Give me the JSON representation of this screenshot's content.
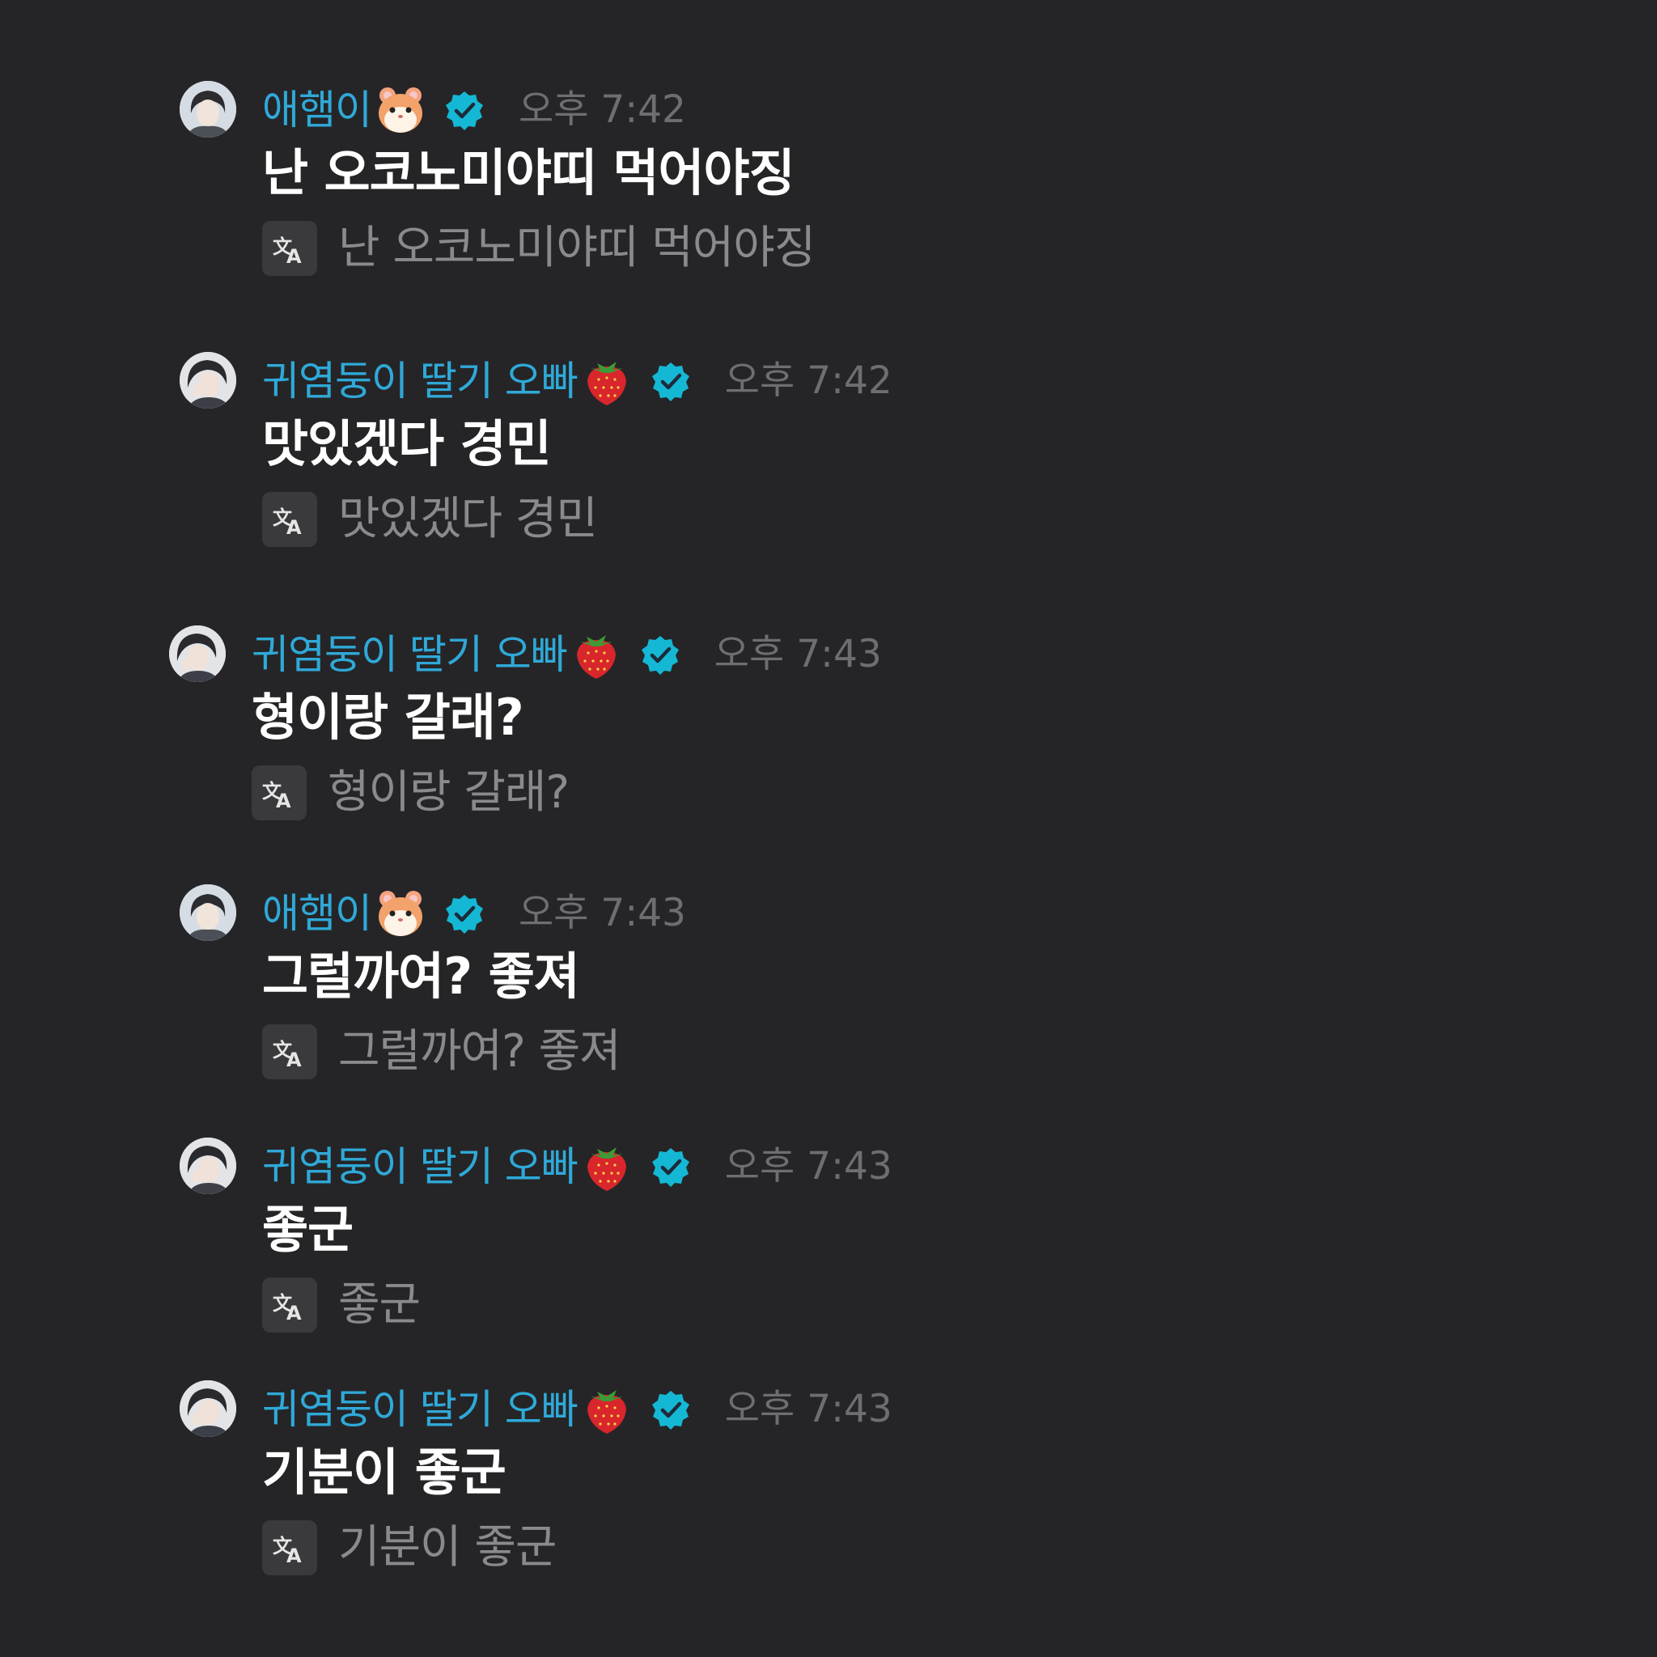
{
  "messages": [
    {
      "sender": "애햄이",
      "sender_emoji": "hamster-emoji",
      "time": "오후 7:42",
      "text": "난 오코노미야띠 먹어야징",
      "translation": "난 오코노미야띠 먹어야징"
    },
    {
      "sender": "귀염둥이 딸기 오빠",
      "sender_emoji": "strawberry-emoji",
      "time": "오후 7:42",
      "text": "맛있겠다 경민",
      "translation": "맛있겠다 경민"
    },
    {
      "sender": "귀염둥이 딸기 오빠",
      "sender_emoji": "strawberry-emoji",
      "time": "오후 7:43",
      "text": "형이랑 갈래?",
      "translation": "형이랑 갈래?"
    },
    {
      "sender": "애햄이",
      "sender_emoji": "hamster-emoji",
      "time": "오후 7:43",
      "text": "그럴까여? 좋져",
      "translation": "그럴까여? 좋져"
    },
    {
      "sender": "귀염둥이 딸기 오빠",
      "sender_emoji": "strawberry-emoji",
      "time": "오후 7:43",
      "text": "좋군",
      "translation": "좋군"
    },
    {
      "sender": "귀염둥이 딸기 오빠",
      "sender_emoji": "strawberry-emoji",
      "time": "오후 7:43",
      "text": "기분이 좋군",
      "translation": "기분이 좋군"
    }
  ],
  "colors": {
    "background": "#252527",
    "sender_name": "#2fa9d8",
    "verified_badge": "#14b8d4",
    "timestamp": "#6e6e72",
    "message_text": "#ffffff",
    "translation_text": "#8a8a8d",
    "translate_icon_bg": "#3a3a3d"
  },
  "icons": {
    "verified": "verified-badge-icon",
    "translate": "translate-icon",
    "avatar": "avatar"
  }
}
